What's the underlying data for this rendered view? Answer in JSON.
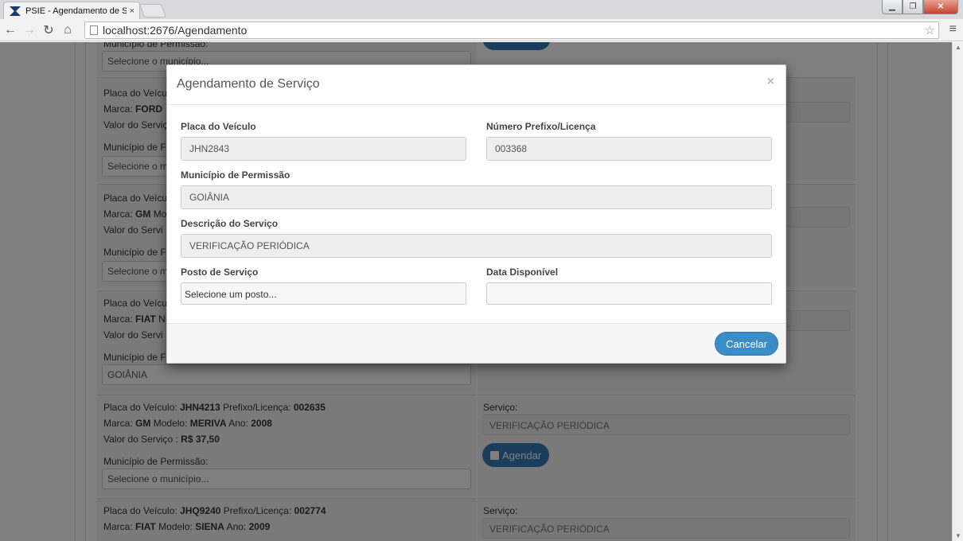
{
  "browser": {
    "tab_title": "PSIE - Agendamento de S",
    "tab_close": "×",
    "url": "localhost:2676/Agendamento",
    "icons": [
      "back-icon",
      "forward-icon",
      "reload-icon",
      "home-icon",
      "bookmark-star-icon",
      "menu-icon"
    ]
  },
  "background": {
    "cards": [
      {
        "left_lines": [
          {
            "kind": "label",
            "text": "Município de Permissão:"
          },
          {
            "kind": "select",
            "text": "Selecione o município..."
          }
        ]
      },
      {
        "line1_prefix": "Placa do Veículo:",
        "line2_prefix": "Marca:",
        "brand": "FORD",
        "line3": "Valor do Serviço",
        "municipio_label": "Município de F",
        "select_text": "Selecione o m"
      },
      {
        "line1_prefix": "Placa do Veículo:",
        "line2_prefix": "Marca:",
        "brand": "GM",
        "line2_tail": "Mo",
        "line3": "Valor do Servi",
        "municipio_label": "Município de F",
        "select_text": "Selecione o m"
      },
      {
        "line1_prefix": "Placa do Veículo:",
        "line2_prefix": "Marca:",
        "brand": "FIAT",
        "line2_tail": "N",
        "line3": "Valor do Servi",
        "municipio_label": "Município de F",
        "select_text": "GOIÂNIA"
      },
      {
        "placa_label": "Placa do Veículo:",
        "placa": "JHN4213",
        "prefixo_label": "Prefixo/Licença:",
        "prefixo": "002635",
        "marca_label": "Marca:",
        "marca": "GM",
        "modelo_label": "Modelo:",
        "modelo": "MERIVA",
        "ano_label": "Ano:",
        "ano": "2008",
        "valor_label": "Valor do Serviço :",
        "valor": "R$ 37,50",
        "municipio_label": "Município de Permissão:",
        "select_text": "Selecione o município...",
        "servico_label": "Serviço:",
        "servico": "VERIFICAÇÃO PERIÓDICA",
        "agendar": "Agendar"
      },
      {
        "placa_label": "Placa do Veículo:",
        "placa": "JHQ9240",
        "prefixo_label": "Prefixo/Licença:",
        "prefixo": "002774",
        "marca_label": "Marca:",
        "marca": "FIAT",
        "modelo_label": "Modelo:",
        "modelo": "SIENA",
        "ano_label": "Ano:",
        "ano": "2009",
        "servico_label": "Serviço:",
        "servico": "VERIFICAÇÃO PERIÓDICA"
      }
    ]
  },
  "modal": {
    "title": "Agendamento de Serviço",
    "close": "×",
    "placa_label": "Placa do Veículo",
    "placa_value": "JHN2843",
    "prefixo_label": "Número Prefixo/Licença",
    "prefixo_value": "003368",
    "municipio_label": "Município de Permissão",
    "municipio_value": "GOIÂNIA",
    "descricao_label": "Descrição do Serviço",
    "descricao_value": "VERIFICAÇÃO PERIÓDICA",
    "posto_label": "Posto de Serviço",
    "posto_placeholder": "Selecione um posto...",
    "data_label": "Data Disponível",
    "data_value": "",
    "cancel_label": "Cancelar"
  }
}
